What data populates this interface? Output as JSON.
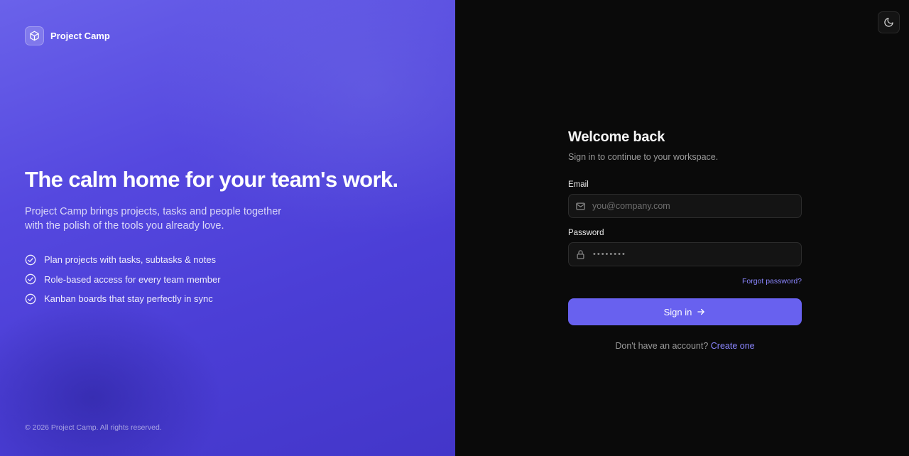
{
  "brand": {
    "name": "Project Camp",
    "icon": "cube-icon"
  },
  "hero": {
    "title": "The calm home for your team's work.",
    "description": "Project Camp brings projects, tasks and people together with the polish of the tools you already love.",
    "features": [
      {
        "text": "Plan projects with tasks, subtasks & notes",
        "icon": "check-circle-icon"
      },
      {
        "text": "Role-based access for every team member",
        "icon": "check-circle-icon"
      },
      {
        "text": "Kanban boards that stay perfectly in sync",
        "icon": "check-circle-icon"
      }
    ]
  },
  "footer": {
    "copyright": "© 2026 Project Camp. All rights reserved."
  },
  "theme_toggle": {
    "icon": "moon-icon"
  },
  "login": {
    "title": "Welcome back",
    "subtitle": "Sign in to continue to your workspace.",
    "email": {
      "label": "Email",
      "placeholder": "you@company.com",
      "value": "",
      "icon": "mail-icon"
    },
    "password": {
      "label": "Password",
      "masked_value": "••••••••",
      "icon": "lock-icon"
    },
    "forgot_label": "Forgot password?",
    "submit_label": "Sign in",
    "submit_icon": "arrow-right-icon",
    "signup_prompt": "Don't have an account?",
    "signup_link": "Create one"
  },
  "colors": {
    "accent": "#6861ef",
    "link": "#8b86ff",
    "left_panel_start": "#6a62ea",
    "left_panel_end": "#4336c9",
    "right_panel_bg": "#0a0a0a"
  }
}
